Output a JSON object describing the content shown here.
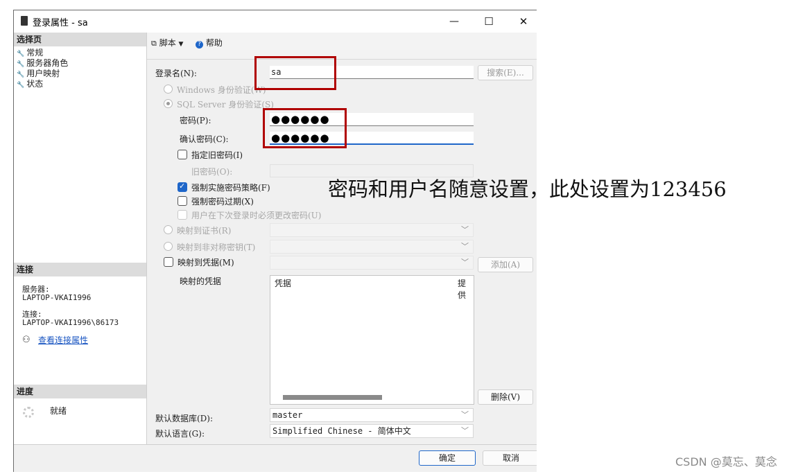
{
  "window": {
    "title": "登录属性 - sa",
    "minimize": "—",
    "maximize": "☐",
    "close": "✕"
  },
  "left": {
    "select_page": "选择页",
    "nav_items": [
      "常规",
      "服务器角色",
      "用户映射",
      "状态"
    ],
    "connection_head": "连接",
    "server_label": "服务器:",
    "server_value": "LAPTOP-VKAI1996",
    "conn_label": "连接:",
    "conn_value": "LAPTOP-VKAI1996\\86173",
    "view_conn_link": "查看连接属性",
    "progress_head": "进度",
    "progress_status": "就绪"
  },
  "toolbar": {
    "script": "脚本",
    "help": "帮助"
  },
  "form": {
    "login_name_label": "登录名(N):",
    "login_name_value": "sa",
    "search_button": "搜索(E)...",
    "windows_auth": "Windows 身份验证(W)",
    "sql_auth": "SQL Server 身份验证(S)",
    "password_label": "密码(P):",
    "password_value": "●●●●●●",
    "confirm_label": "确认密码(C):",
    "confirm_value": "●●●●●●",
    "old_pwd_check": "指定旧密码(I)",
    "old_pwd_label": "旧密码(O):",
    "enforce_policy": "强制实施密码策略(F)",
    "enforce_expiry": "强制密码过期(X)",
    "must_change": "用户在下次登录时必须更改密码(U)",
    "map_cert": "映射到证书(R)",
    "map_asym": "映射到非对称密钥(T)",
    "map_cred": "映射到凭据(M)",
    "add_button": "添加(A)",
    "mapped_creds_label": "映射的凭据",
    "col_cred": "凭据",
    "col_provider": "提供",
    "delete_button": "删除(V)",
    "default_db_label": "默认数据库(D):",
    "default_db_value": "master",
    "default_lang_label": "默认语言(G):",
    "default_lang_value": "Simplified Chinese - 简体中文"
  },
  "footer": {
    "ok": "确定",
    "cancel": "取消"
  },
  "annotation": "密码和用户名随意设置，此处设置为123456",
  "watermark": "CSDN @莫忘、莫念",
  "colors": {
    "highlight_box": "#b00000",
    "checkbox_checked": "#1e66c9",
    "link": "#1a56c2"
  }
}
